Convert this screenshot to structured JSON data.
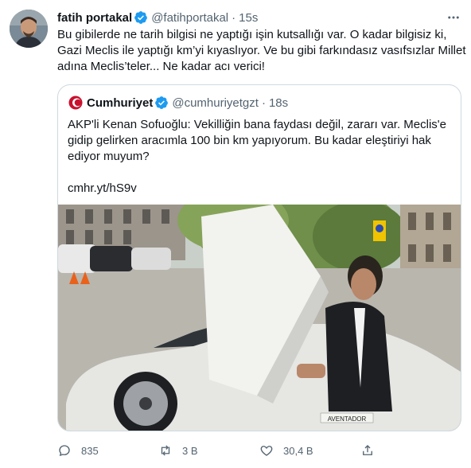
{
  "tweet": {
    "author_name": "fatih portakal",
    "author_handle": "@fatihportakal",
    "separator": "·",
    "time": "15s",
    "text_lines": [
      "Bu gibilerde ne tarih bilgisi ne yaptığı işin kutsallığı var. O kadar bilgisiz ki,",
      "Gazi Meclis ile yaptığı km’yi kıyaslıyor. Ve bu gibi farkındasız vasıfsızlar Millet",
      "adına Meclis’teler... Ne kadar acı verici!"
    ]
  },
  "quote": {
    "author_name": "Cumhuriyet",
    "author_handle": "@cumhuriyetgzt",
    "separator": "·",
    "time": "18s",
    "text_lines": [
      "AKP'li Kenan Sofuoğlu: Vekilliğin bana faydası değil, zararı var. Meclis'e",
      "gidip gelirken aracımla 100 bin km yapıyorum. Bu kadar eleştiriyi hak",
      "ediyor muyum?"
    ],
    "link": "cmhr.yt/hS9v",
    "car_badge": "AVENTADOR"
  },
  "actions": {
    "reply_count": "835",
    "retweet_count": "3 B",
    "like_count": "30,4 B"
  },
  "colors": {
    "verified": "#1d9bf0",
    "secondary_text": "#536471",
    "border": "#cfd9de",
    "cumhuriyet_red": "#c8102e"
  }
}
